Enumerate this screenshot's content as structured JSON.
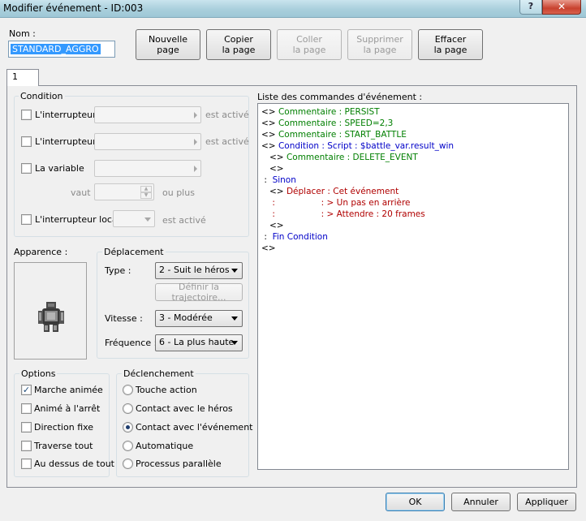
{
  "window": {
    "title": "Modifier événement - ID:003",
    "help_glyph": "?",
    "close_glyph": "✕"
  },
  "name": {
    "label": "Nom :",
    "value": "STANDARD_AGGRO"
  },
  "toolbar": {
    "new_page": [
      "Nouvelle",
      "page"
    ],
    "copy_page": [
      "Copier",
      "la page"
    ],
    "paste_page": [
      "Coller",
      "la page"
    ],
    "delete_page": [
      "Supprimer",
      "la page"
    ],
    "clear_page": [
      "Effacer",
      "la page"
    ]
  },
  "tabs": [
    {
      "label": "1"
    }
  ],
  "conditions": {
    "title": "Condition",
    "switch1_label": "L'interrupteur",
    "switch2_label": "L'interrupteur",
    "variable_label": "La variable",
    "value_label": "vaut",
    "or_more": "ou plus",
    "self_switch_label": "L'interrupteur local",
    "is_active": "est activé"
  },
  "appearance": {
    "title": "Apparence :"
  },
  "movement": {
    "title": "Déplacement",
    "type_label": "Type :",
    "type_value": "2 - Suit le héros",
    "route_button": "Définir la trajectoire...",
    "speed_label": "Vitesse :",
    "speed_value": "3 - Modérée",
    "freq_label": "Fréquence :",
    "freq_value": "6 - La plus haute"
  },
  "options": {
    "title": "Options",
    "items": [
      {
        "label": "Marche animée",
        "checked": true
      },
      {
        "label": "Animé à l'arrêt",
        "checked": false
      },
      {
        "label": "Direction fixe",
        "checked": false
      },
      {
        "label": "Traverse tout",
        "checked": false
      },
      {
        "label": "Au dessus de tout",
        "checked": false
      }
    ]
  },
  "trigger": {
    "title": "Déclenchement",
    "items": [
      {
        "label": "Touche action",
        "selected": false
      },
      {
        "label": "Contact avec le héros",
        "selected": false
      },
      {
        "label": "Contact avec l'événement",
        "selected": true
      },
      {
        "label": "Automatique",
        "selected": false
      },
      {
        "label": "Processus parallèle",
        "selected": false
      }
    ]
  },
  "commands": {
    "title": "Liste des commandes d'événement :",
    "lines": [
      {
        "prefix": "<> ",
        "text": "Commentaire : PERSIST",
        "color": "#007f00"
      },
      {
        "prefix": "<> ",
        "text": "Commentaire : SPEED=2,3",
        "color": "#007f00"
      },
      {
        "prefix": "<> ",
        "text": "Commentaire : START_BATTLE",
        "color": "#007f00"
      },
      {
        "prefix": "<> ",
        "text": "Condition : Script : $battle_var.result_win",
        "color": "#0000c8"
      },
      {
        "prefix": "   <> ",
        "text": "Commentaire : DELETE_EVENT",
        "color": "#007f00"
      },
      {
        "prefix": "   <>",
        "text": "",
        "color": "#000000"
      },
      {
        "prefix": " :  ",
        "text": "Sinon",
        "color": "#0000c8"
      },
      {
        "prefix": "   <> ",
        "text": "Déplacer : Cet événement",
        "color": "#b00000"
      },
      {
        "prefix": "    :                 ",
        "text": ": > Un pas en arrière",
        "color": "#b00000"
      },
      {
        "prefix": "    :                 ",
        "text": ": > Attendre : 20 frames",
        "color": "#b00000"
      },
      {
        "prefix": "   <>",
        "text": "",
        "color": "#000000"
      },
      {
        "prefix": " :  ",
        "text": "Fin Condition",
        "color": "#0000c8"
      },
      {
        "prefix": "<>",
        "text": "",
        "color": "#000000"
      }
    ]
  },
  "footer": {
    "ok": "OK",
    "cancel": "Annuler",
    "apply": "Appliquer"
  }
}
